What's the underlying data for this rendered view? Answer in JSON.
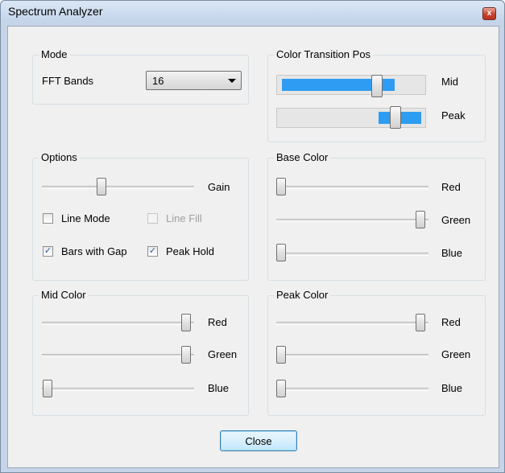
{
  "window": {
    "title": "Spectrum Analyzer",
    "close_glyph": "x"
  },
  "mode": {
    "group_label": "Mode",
    "fft_label": "FFT Bands",
    "fft_value": "16"
  },
  "color_transition": {
    "group_label": "Color Transition Pos",
    "mid_label": "Mid",
    "mid_level": 0.85,
    "peak_label": "Peak",
    "peak_level_start": 0.7,
    "peak_level_end": 1.0
  },
  "options": {
    "group_label": "Options",
    "gain_label": "Gain",
    "gain_level": 0.37,
    "line_mode": {
      "label": "Line Mode",
      "checked": false,
      "enabled": true
    },
    "line_fill": {
      "label": "Line Fill",
      "checked": false,
      "enabled": false
    },
    "bars_with_gap": {
      "label": "Bars with Gap",
      "checked": true,
      "enabled": true
    },
    "peak_hold": {
      "label": "Peak Hold",
      "checked": true,
      "enabled": true
    }
  },
  "base_color": {
    "group_label": "Base Color",
    "red_label": "Red",
    "red_level": 0.0,
    "green_label": "Green",
    "green_level": 1.0,
    "blue_label": "Blue",
    "blue_level": 0.0
  },
  "mid_color": {
    "group_label": "Mid Color",
    "red_label": "Red",
    "red_level": 1.0,
    "green_label": "Green",
    "green_level": 1.0,
    "blue_label": "Blue",
    "blue_level": 0.0
  },
  "peak_color": {
    "group_label": "Peak Color",
    "red_label": "Red",
    "red_level": 1.0,
    "green_label": "Green",
    "green_level": 0.0,
    "blue_label": "Blue",
    "blue_level": 0.0
  },
  "footer": {
    "close_label": "Close"
  },
  "colors": {
    "accent": "#2d9cf2",
    "title_close": "#c7422f"
  },
  "icons": {
    "close": "close-icon",
    "check": "checkmark-icon",
    "dropdown": "chevron-down-icon"
  }
}
